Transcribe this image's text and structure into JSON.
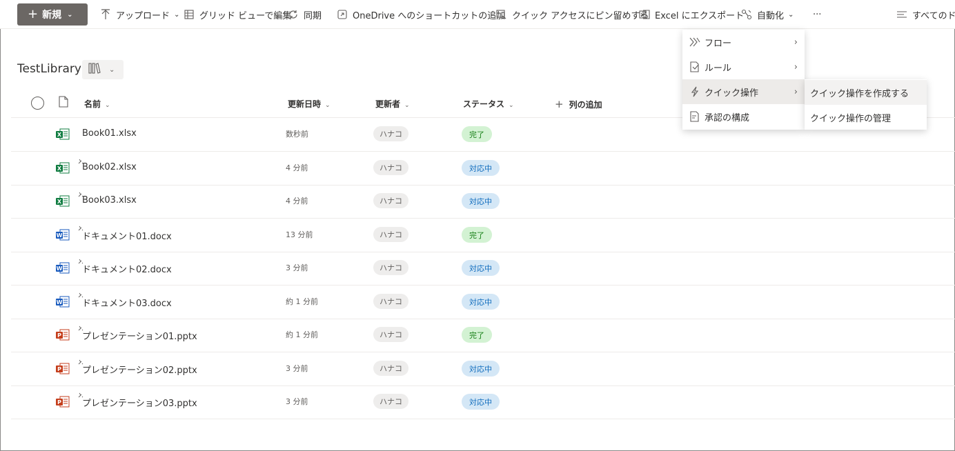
{
  "commandbar": {
    "new_label": "新規",
    "upload_label": "アップロード",
    "grid_label": "グリッド ビューで編集",
    "sync_label": "同期",
    "onedrive_label": "OneDrive へのショートカットの追加",
    "pin_label": "クイック アクセスにピン留めする",
    "excel_label": "Excel にエクスポート",
    "automate_label": "自動化",
    "more_label": "···",
    "alldocs_label": "すべてのドキ"
  },
  "library": {
    "title": "TestLibrary"
  },
  "columns": {
    "name": "名前",
    "modified": "更新日時",
    "modified_by": "更新者",
    "status": "ステータス",
    "add_column": "列の追加"
  },
  "files": [
    {
      "name": "Book01.xlsx",
      "type": "excel",
      "modified": "数秒前",
      "modified_by": "ハナコ",
      "status": "完了",
      "new": false
    },
    {
      "name": "Book02.xlsx",
      "type": "excel",
      "modified": "4 分前",
      "modified_by": "ハナコ",
      "status": "対応中",
      "new": true
    },
    {
      "name": "Book03.xlsx",
      "type": "excel",
      "modified": "4 分前",
      "modified_by": "ハナコ",
      "status": "対応中",
      "new": true
    },
    {
      "name": "ドキュメント01.docx",
      "type": "word",
      "modified": "13 分前",
      "modified_by": "ハナコ",
      "status": "完了",
      "new": true
    },
    {
      "name": "ドキュメント02.docx",
      "type": "word",
      "modified": "3 分前",
      "modified_by": "ハナコ",
      "status": "対応中",
      "new": true
    },
    {
      "name": "ドキュメント03.docx",
      "type": "word",
      "modified": "約 1 分前",
      "modified_by": "ハナコ",
      "status": "対応中",
      "new": true
    },
    {
      "name": "プレゼンテーション01.pptx",
      "type": "powerpoint",
      "modified": "約 1 分前",
      "modified_by": "ハナコ",
      "status": "完了",
      "new": true
    },
    {
      "name": "プレゼンテーション02.pptx",
      "type": "powerpoint",
      "modified": "3 分前",
      "modified_by": "ハナコ",
      "status": "対応中",
      "new": true
    },
    {
      "name": "プレゼンテーション03.pptx",
      "type": "powerpoint",
      "modified": "3 分前",
      "modified_by": "ハナコ",
      "status": "対応中",
      "new": true
    }
  ],
  "status_colors": {
    "完了": {
      "bg": "#d3f2d3",
      "fg": "#107c10"
    },
    "対応中": {
      "bg": "#d4e7f6",
      "fg": "#0f6cbd"
    }
  },
  "file_icon_colors": {
    "excel": "#107c41",
    "word": "#185abd",
    "powerpoint": "#c43e1c"
  },
  "automate_menu": {
    "items": [
      {
        "label": "フロー",
        "icon": "flow-icon"
      },
      {
        "label": "ルール",
        "icon": "rules-icon"
      },
      {
        "label": "クイック操作",
        "icon": "lightning-icon"
      },
      {
        "label": "承認の構成",
        "icon": "approval-icon"
      }
    ]
  },
  "quick_action_submenu": {
    "items": [
      {
        "label": "クイック操作を作成する"
      },
      {
        "label": "クイック操作の管理"
      }
    ]
  }
}
